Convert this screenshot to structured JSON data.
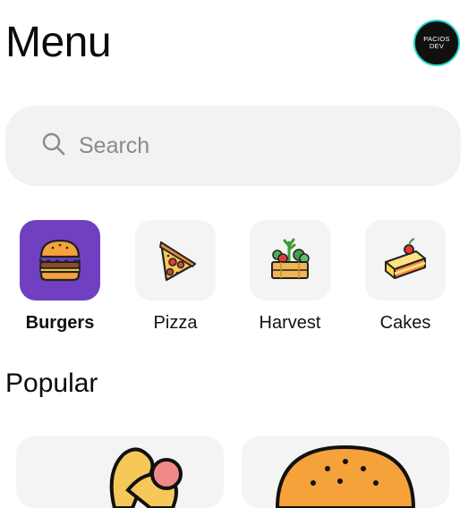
{
  "header": {
    "title": "Menu",
    "avatar": {
      "line1": "PACIOS",
      "line2": "DEV"
    }
  },
  "search": {
    "placeholder": "Search",
    "icon": "search-icon"
  },
  "categories": [
    {
      "label": "Burgers",
      "icon": "burger-icon",
      "active": true
    },
    {
      "label": "Pizza",
      "icon": "pizza-slice-icon",
      "active": false
    },
    {
      "label": "Harvest",
      "icon": "vegetable-crate-icon",
      "active": false
    },
    {
      "label": "Cakes",
      "icon": "cake-slice-icon",
      "active": false
    }
  ],
  "popular": {
    "title": "Popular",
    "cards": [
      {
        "icon": "fries-icon"
      },
      {
        "icon": "burger-bun-icon"
      }
    ]
  },
  "colors": {
    "active_category": "#7040c0",
    "card_background": "#f4f4f4",
    "avatar_ring": "#1ed6c8"
  }
}
